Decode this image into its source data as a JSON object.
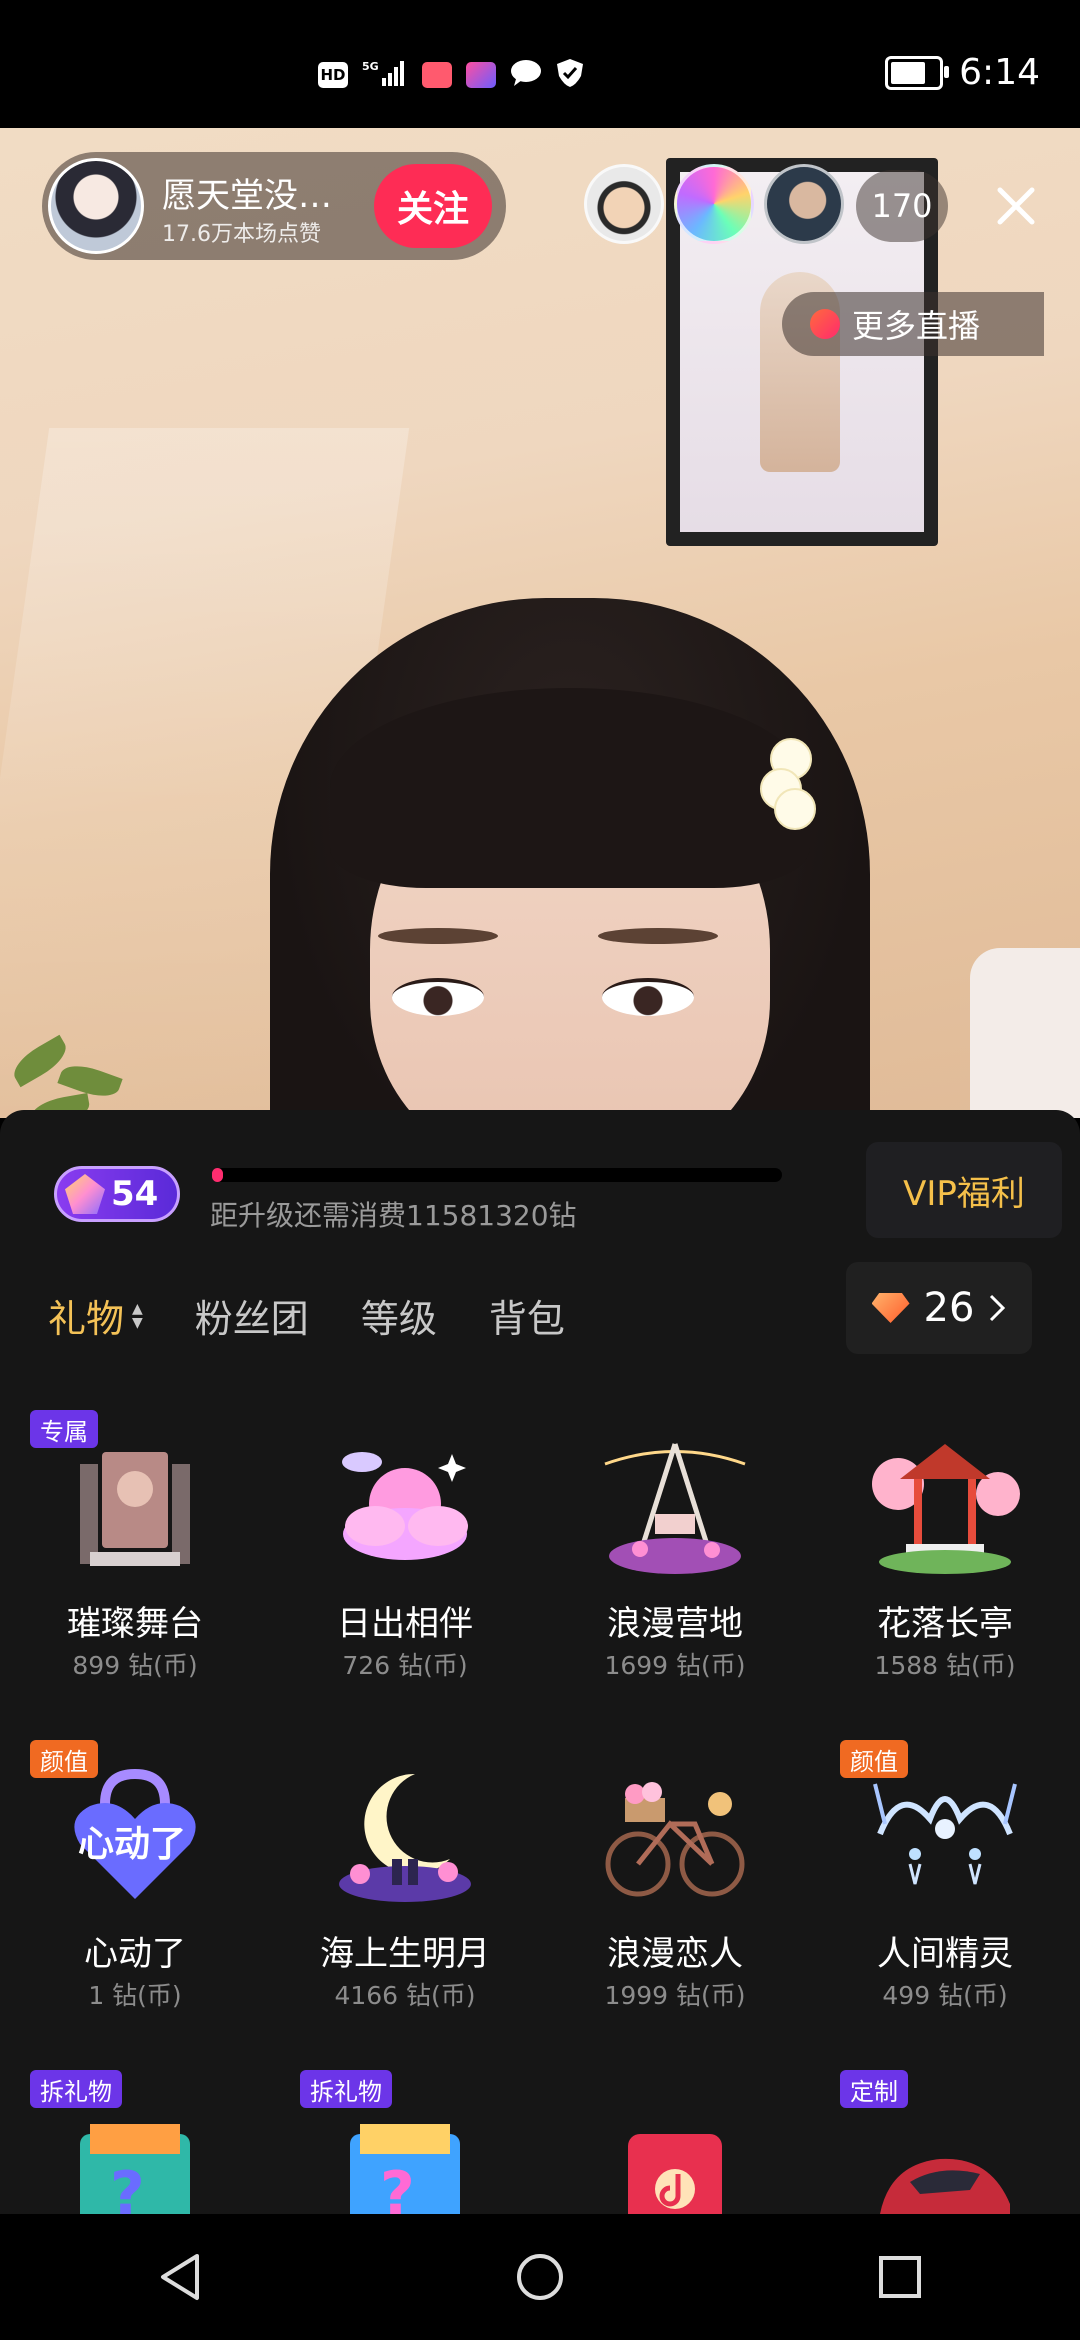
{
  "status_bar": {
    "time": "6:14",
    "left_icons": [
      "hd-icon",
      "5g-signal-icon",
      "app-notification-icon",
      "app-notification-icon-2",
      "chat-icon",
      "shield-icon"
    ],
    "battery_level": 0.85
  },
  "live": {
    "host_name": "愿天堂没…",
    "host_likes": "17.6万本场点赞",
    "follow_label": "关注",
    "viewer_count": "170",
    "more_live_label": "更多直播"
  },
  "panel": {
    "level": "54",
    "progress_fraction": 0.02,
    "progress_text": "距升级还需消费11581320钻",
    "vip_label": "VIP福利",
    "tabs": [
      {
        "label": "礼物"
      },
      {
        "label": "粉丝团"
      },
      {
        "label": "等级"
      },
      {
        "label": "背包"
      }
    ],
    "balance": "26",
    "gifts": [
      {
        "name": "璀璨舞台",
        "price": "899 钻(币)",
        "tag": "专属",
        "tag_color": "purple",
        "icon": "stage-gift-icon"
      },
      {
        "name": "日出相伴",
        "price": "726 钻(币)",
        "tag": "",
        "icon": "sunrise-cloud-gift-icon"
      },
      {
        "name": "浪漫营地",
        "price": "1699 钻(币)",
        "tag": "",
        "icon": "camp-swing-gift-icon"
      },
      {
        "name": "花落长亭",
        "price": "1588 钻(币)",
        "tag": "",
        "icon": "pavilion-gift-icon"
      },
      {
        "name": "心动了",
        "price": "1 钻(币)",
        "tag": "颜值",
        "tag_color": "orange",
        "icon": "heart-lock-gift-icon"
      },
      {
        "name": "海上生明月",
        "price": "4166 钻(币)",
        "tag": "",
        "icon": "moon-gift-icon"
      },
      {
        "name": "浪漫恋人",
        "price": "1999 钻(币)",
        "tag": "",
        "icon": "bicycle-gift-icon"
      },
      {
        "name": "人间精灵",
        "price": "499 钻(币)",
        "tag": "颜值",
        "tag_color": "orange",
        "icon": "fairy-tiara-gift-icon"
      },
      {
        "name": "",
        "price": "",
        "tag": "拆礼物",
        "tag_color": "purple",
        "icon": "mystery-box-gift-icon"
      },
      {
        "name": "",
        "price": "",
        "tag": "拆礼物",
        "tag_color": "purple",
        "icon": "mystery-box-gift-icon-2"
      },
      {
        "name": "",
        "price": "",
        "tag": "",
        "icon": "douyin-red-packet-icon"
      },
      {
        "name": "",
        "price": "",
        "tag": "定制",
        "tag_color": "purple",
        "icon": "sports-car-gift-icon"
      }
    ]
  },
  "colors": {
    "accent_gold": "#f4c257",
    "follow_red": "#fe2c55",
    "panel_bg": "#161616",
    "tag_purple": "#6c35e8",
    "tag_orange": "#f06a22"
  }
}
